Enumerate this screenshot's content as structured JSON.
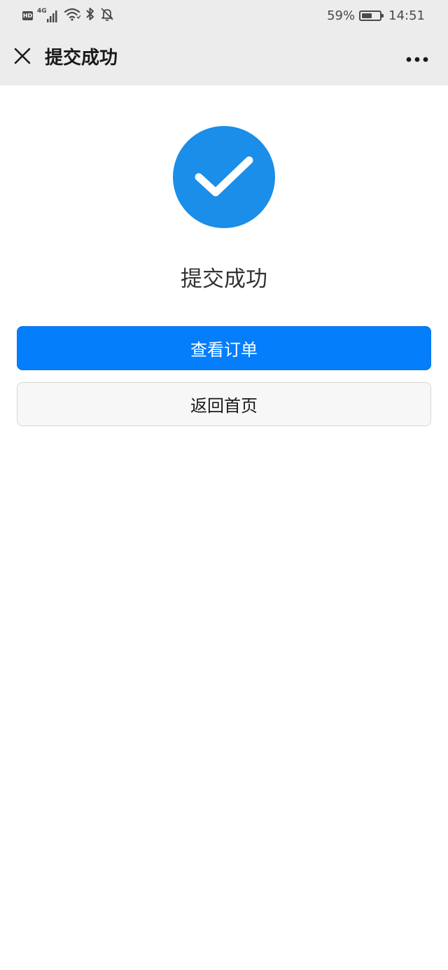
{
  "status_bar": {
    "network_label": "4G",
    "battery_percent": "59%",
    "battery_level": 0.59,
    "time": "14:51",
    "icons": [
      "hd-icon",
      "signal-icon",
      "wifi-icon",
      "bluetooth-icon",
      "mute-bell-icon",
      "battery-icon"
    ]
  },
  "header": {
    "close_icon": "close-icon",
    "title": "提交成功",
    "more_icon": "more-icon"
  },
  "result": {
    "icon": "check-circle-icon",
    "icon_color": "#1a8ee8",
    "message": "提交成功"
  },
  "actions": {
    "primary_label": "查看订单",
    "primary_color": "#057efc",
    "secondary_label": "返回首页"
  }
}
